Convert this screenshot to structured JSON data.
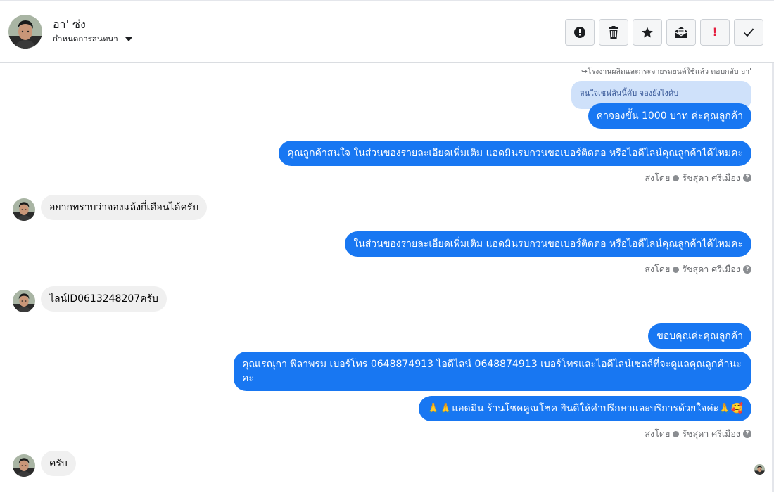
{
  "contact": {
    "name": "อา' ซ่ง",
    "conversation_setting": "กำหนดการสนทนา"
  },
  "actions": [
    {
      "name": "spam",
      "icon": "alert-circle-icon"
    },
    {
      "name": "delete",
      "icon": "trash-icon"
    },
    {
      "name": "star",
      "icon": "star-icon"
    },
    {
      "name": "mark-unread",
      "icon": "envelope-open-icon"
    },
    {
      "name": "important",
      "icon": "exclamation-icon",
      "label": "!"
    },
    {
      "name": "done",
      "icon": "check-icon"
    }
  ],
  "thread": {
    "reply_reference": "↪โรงงานผลิตและกระจายรถยนต์ใช้แล้ว ตอบกลับ อา'",
    "quoted_message": "สนใจเชฟลันนี้คับ จองยังไงคับ",
    "messages": [
      "ค่าจองขั้น 1000  บาท ค่ะคุณลูกค้า",
      "คุณลูกค้าสนใจ ในส่วนของรายละเอียดเพิ่มเติม แอดมินรบกวนขอเบอร์ติดต่อ หรือไอดีไลน์คุณลูกค้าได้ไหมคะ",
      "อยากทราบว่าจองแล้งกี่เดือนได้ครับ",
      "ในส่วนของรายละเอียดเพิ่มเติม แอดมินรบกวนขอเบอร์ติดต่อ หรือไอดีไลน์คุณลูกค้าได้ไหมคะ",
      "ไลน์ID0613248207ครับ",
      "ขอบคุณค่ะคุณลูกค้า",
      "คุณเรณุกา พิลาพรม        เบอร์โทร 0648874913  ไอดีไลน์ 0648874913   เบอร์โทรและไอดีไลน์เซลล์ที่จะดูแลคุณลูกค้านะคะ",
      "🙏🙏แอดมิน ร้านโชคคูณโชค ยินดีให้คำปรึกษาและบริการด้วยใจค่ะ🙏🥰",
      "ครับ"
    ],
    "sent_by": {
      "prefix": "ส่งโดย",
      "agent": "รัชสุดา ศรีเมือง",
      "help": "?"
    }
  },
  "colors": {
    "outgoing_bubble": "#1877f2",
    "incoming_bubble": "#f0f0f0",
    "meta_text": "#65676b"
  }
}
